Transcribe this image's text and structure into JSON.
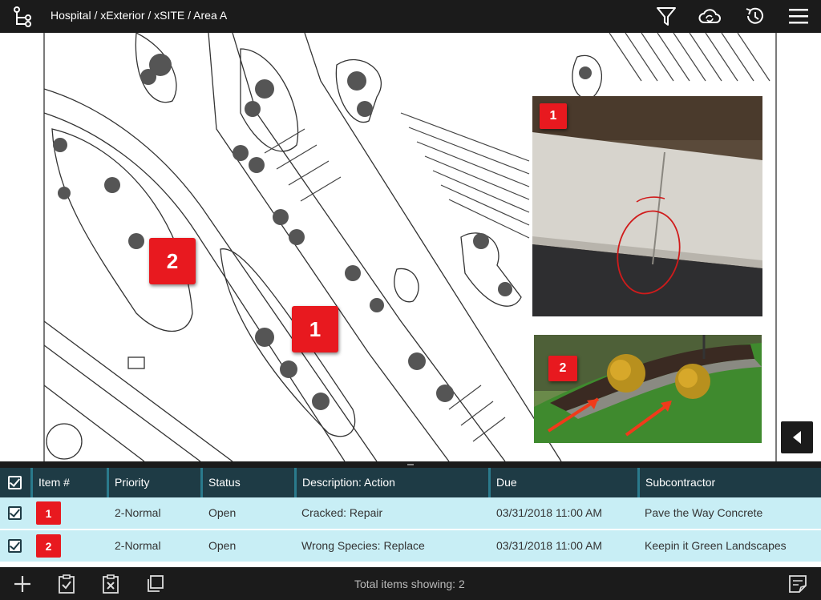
{
  "header": {
    "breadcrumb": "Hospital / xExterior / xSITE / Area A"
  },
  "plan": {
    "markers": [
      {
        "label": "1"
      },
      {
        "label": "2"
      }
    ],
    "photos": [
      {
        "label": "1"
      },
      {
        "label": "2"
      }
    ]
  },
  "table": {
    "columns": [
      "Item #",
      "Priority",
      "Status",
      "Description: Action",
      "Due",
      "Subcontractor"
    ],
    "rows": [
      {
        "item": "1",
        "priority": "2-Normal",
        "status": "Open",
        "description": "Cracked: Repair",
        "due": "03/31/2018 11:00 AM",
        "subcontractor": "Pave the Way Concrete"
      },
      {
        "item": "2",
        "priority": "2-Normal",
        "status": "Open",
        "description": "Wrong Species: Replace",
        "due": "03/31/2018 11:00 AM",
        "subcontractor": "Keepin it Green Landscapes"
      }
    ]
  },
  "footer": {
    "total_label": "Total items showing: 2"
  },
  "colors": {
    "bar": "#1b1b1b",
    "table_header": "#1e3b45",
    "row_selected": "#c8eef5",
    "marker": "#e8191f"
  },
  "icons": [
    "tree-icon",
    "filter-icon",
    "cloud-sync-icon",
    "history-icon",
    "menu-icon",
    "add-icon",
    "clipboard-check-icon",
    "clipboard-x-icon",
    "copy-icon",
    "edit-note-icon",
    "chevron-left-icon"
  ]
}
